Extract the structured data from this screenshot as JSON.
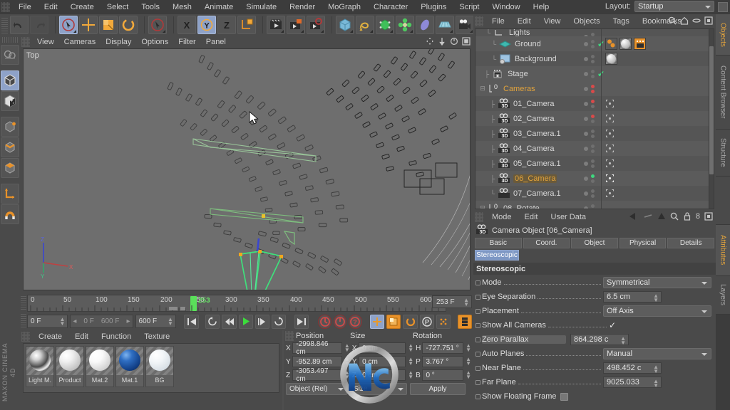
{
  "app": {
    "name": "CINEMA 4D",
    "vendor": "MAXON",
    "menus": [
      "File",
      "Edit",
      "Create",
      "Select",
      "Tools",
      "Mesh",
      "Animate",
      "Simulate",
      "Render",
      "MoGraph",
      "Character",
      "Plugins",
      "Script",
      "Window",
      "Help"
    ],
    "layout_label": "Layout:",
    "layout_value": "Startup"
  },
  "toolbar": {
    "undo": "undo-arrow",
    "redo": "redo-arrow",
    "live_selection": "live-selection-tool",
    "move": "move-tool",
    "scale": "scale-tool",
    "rotate": "rotate-tool",
    "selection_alt": "selection-tool",
    "axis_x": "X",
    "axis_y": "Y",
    "axis_z": "Z",
    "world_object": "world-object-axis",
    "render_view": "render-view",
    "render_region": "render-region",
    "render_settings": "render-settings",
    "primitive_cube": "cube-primitive",
    "spline": "spline-pen",
    "nurbs": "nurbs-generator",
    "array": "array-deformer",
    "deformer": "bend-deformer",
    "floor": "floor-environment",
    "camera": "camera-object",
    "light": "light-object"
  },
  "left_tools": [
    {
      "name": "model-tool",
      "selected": true
    },
    {
      "name": "texture-tool",
      "selected": false
    },
    {
      "name": "points-tool",
      "selected": false
    },
    {
      "name": "edges-tool",
      "selected": false
    },
    {
      "name": "polygons-tool",
      "selected": false
    },
    {
      "name": "axis-tool",
      "selected": false
    },
    {
      "name": "enable-snap",
      "selected": false
    }
  ],
  "viewport": {
    "menus": [
      "View",
      "Cameras",
      "Display",
      "Options",
      "Filter",
      "Panel"
    ],
    "view_label": "Top",
    "axis_labels": {
      "z": "Z",
      "y": "Y",
      "x": "X"
    }
  },
  "timeline": {
    "tick_labels": [
      "0",
      "50",
      "100",
      "150",
      "200",
      "250",
      "300",
      "350",
      "400",
      "450",
      "500",
      "550",
      "600"
    ],
    "range_start": 0,
    "range_end": 600,
    "current_frame": 253,
    "current_frame_display": "253",
    "frame_field": "253 F",
    "start_field": "0 F",
    "preview_min": "0 F",
    "preview_max": "600 F",
    "end_field": "600 F",
    "transport": [
      "go-to-start",
      "play-backward-loop",
      "step-back",
      "play",
      "step-forward",
      "loop-play",
      "go-to-end"
    ],
    "record_buttons": [
      "record-active-objects",
      "autokeying",
      "keyframe-selection"
    ],
    "key_mode_buttons": [
      "position-key",
      "scale-key",
      "rotation-key",
      "param-key",
      "point-level-key",
      "animation-mode"
    ]
  },
  "materials": {
    "menus": [
      "Create",
      "Edit",
      "Function",
      "Texture"
    ],
    "items": [
      {
        "name": "Light M.",
        "color": "#b8b8b8",
        "type": "metal"
      },
      {
        "name": "Product",
        "color": "#e8e8e8",
        "type": "matte"
      },
      {
        "name": "Mat.2",
        "color": "#f2f2f2",
        "type": "gloss"
      },
      {
        "name": "Mat.1",
        "color": "#18509c",
        "type": "gloss"
      },
      {
        "name": "BG",
        "color": "#e2e8ec",
        "type": "matte"
      }
    ]
  },
  "coordinates": {
    "headers": [
      "Position",
      "Size",
      "Rotation"
    ],
    "position": {
      "X": "-2998.846 cm",
      "Y": "-952.89 cm",
      "Z": "-3053.497 cm"
    },
    "size": {
      "X": "0 cm",
      "Y": "0 cm",
      "Z": "0 cm"
    },
    "rotation": {
      "H": "-727.751 °",
      "P": "3.767 °",
      "B": "0 °"
    },
    "space_mode": "Object (Rel)",
    "size_mode": "Size",
    "apply_label": "Apply"
  },
  "object_manager": {
    "menus": [
      "File",
      "Edit",
      "View",
      "Objects",
      "Tags",
      "Bookmarks"
    ],
    "icons": [
      "search-icon",
      "home-icon",
      "ellipse-icon",
      "fit-icon"
    ],
    "rows": [
      {
        "label": "Lights",
        "icon": "null-object-icon",
        "indent": 1,
        "selected": false,
        "clipped": true,
        "tags": []
      },
      {
        "label": "Ground",
        "icon": "plane-object-icon",
        "indent": 2,
        "selected": false,
        "check": true,
        "tags": [
          "material-orange",
          "material-sphere",
          "texture-tag"
        ]
      },
      {
        "label": "Background",
        "icon": "background-object-icon",
        "indent": 2,
        "selected": false,
        "tags": [
          "material-sphere"
        ]
      },
      {
        "label": "Stage",
        "icon": "stage-object-icon",
        "indent": 1,
        "selected": false,
        "check": true,
        "tags": []
      },
      {
        "label": "Cameras",
        "icon": "null-zero-icon",
        "indent": 1,
        "selected": true,
        "tags": []
      },
      {
        "label": "01_Camera",
        "icon": "camera-3d-icon",
        "indent": 2,
        "selected": false,
        "tags": [
          "protection-tag"
        ]
      },
      {
        "label": "02_Camera",
        "icon": "camera-3d-icon",
        "indent": 2,
        "selected": false,
        "tags": [
          "protection-tag"
        ]
      },
      {
        "label": "03_Camera.1",
        "icon": "camera-3d-icon",
        "indent": 2,
        "selected": false,
        "tags": [
          "protection-tag"
        ]
      },
      {
        "label": "04_Camera",
        "icon": "camera-3d-icon",
        "indent": 2,
        "selected": false,
        "tags": [
          "protection-tag"
        ]
      },
      {
        "label": "05_Camera.1",
        "icon": "camera-3d-icon",
        "indent": 2,
        "selected": false,
        "tags": [
          "protection-tag"
        ]
      },
      {
        "label": "06_Camera",
        "icon": "camera-3d-icon",
        "indent": 2,
        "selected": true,
        "active": true,
        "tags": [
          "protection-tag"
        ]
      },
      {
        "label": "07_Camera.1",
        "icon": "camera-icon",
        "indent": 2,
        "selected": false,
        "tags": [
          "protection-tag"
        ]
      },
      {
        "label": "08_Rotate",
        "icon": "null-zero-icon",
        "indent": 1,
        "selected": false,
        "tags": []
      }
    ]
  },
  "attributes": {
    "menus": [
      "Mode",
      "Edit",
      "User Data"
    ],
    "object_title": "Camera Object [06_Camera]",
    "tabs": [
      "Basic",
      "Coord.",
      "Object",
      "Physical",
      "Details"
    ],
    "tabs_row2": [
      "Stereoscopic"
    ],
    "active_tab": "Stereoscopic",
    "section_title": "Stereoscopic",
    "fields": [
      {
        "label": "Mode",
        "type": "dropdown",
        "value": "Symmetrical"
      },
      {
        "label": "Eye Separation",
        "type": "number",
        "value": "6.5 cm"
      },
      {
        "label": "Placement",
        "type": "dropdown",
        "value": "Off Axis"
      },
      {
        "label": "Show All Cameras",
        "type": "check",
        "value": "✓"
      },
      {
        "label": "Zero Parallax",
        "type": "number",
        "value": "864.298 c",
        "highlight": true
      },
      {
        "label": "Auto Planes",
        "type": "dropdown",
        "value": "Manual"
      },
      {
        "label": "Near Plane",
        "type": "number",
        "value": "498.452 c"
      },
      {
        "label": "Far Plane",
        "type": "number",
        "value": "9025.033 "
      },
      {
        "label": "Show Floating Frame",
        "type": "checkbox",
        "value": ""
      }
    ]
  },
  "right_tabs": [
    {
      "label": "Objects",
      "active": true
    },
    {
      "label": "Content Browser",
      "active": false
    },
    {
      "label": "Structure",
      "active": false
    },
    {
      "label": "Attributes",
      "active": true
    },
    {
      "label": "Layers",
      "active": false
    }
  ],
  "colors": {
    "accent_orange": "#e2a33c",
    "selection_blue": "#8ea2c8",
    "play_green": "#5ae05a",
    "panel_bg": "#4a4a4a",
    "viewport_bg": "#6e6e6e"
  }
}
